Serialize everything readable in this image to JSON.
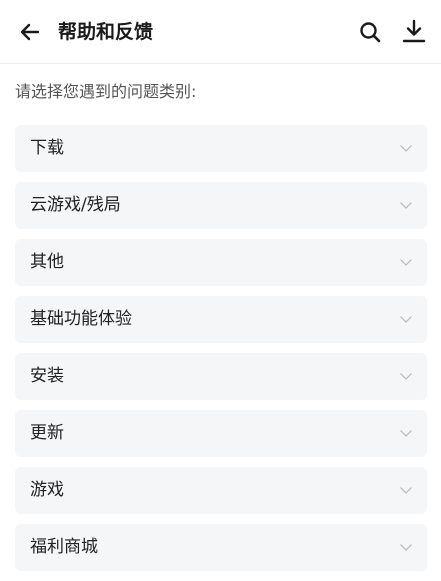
{
  "header": {
    "title": "帮助和反馈"
  },
  "prompt": "请选择您遇到的问题类别:",
  "categories": [
    {
      "label": "下载"
    },
    {
      "label": "云游戏/残局"
    },
    {
      "label": "其他"
    },
    {
      "label": "基础功能体验"
    },
    {
      "label": "安装"
    },
    {
      "label": "更新"
    },
    {
      "label": "游戏"
    },
    {
      "label": "福利商城"
    }
  ],
  "icons": {
    "back": "arrow-left-icon",
    "search": "search-icon",
    "download": "download-icon",
    "expand": "chevron-down-icon"
  },
  "colors": {
    "text": "#1a1a1a",
    "item_bg": "#f5f6f8",
    "chevron": "#b8b8b8"
  }
}
